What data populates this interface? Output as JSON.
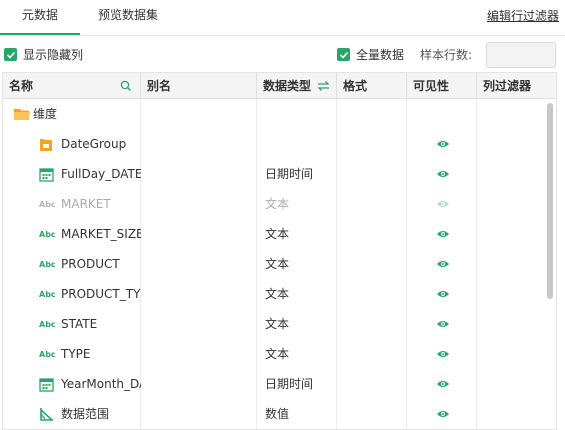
{
  "tabs": {
    "metadata": "元数据",
    "preview": "预览数据集"
  },
  "edit_filter_link": "编辑行过滤器",
  "options": {
    "show_hidden_label": "显示隐藏列",
    "show_hidden_checked": true,
    "full_data_label": "全量数据",
    "full_data_checked": true,
    "sample_rows_label": "样本行数:",
    "sample_rows_value": ""
  },
  "columns": {
    "name": "名称",
    "alias": "别名",
    "data_type": "数据类型",
    "format": "格式",
    "visibility": "可见性",
    "column_filter": "列过滤器"
  },
  "rows": [
    {
      "name": "维度",
      "type": "",
      "icon": "folder-icon",
      "visible": null
    },
    {
      "name": "DateGroup",
      "type": "",
      "icon": "date-group-icon",
      "visible": true
    },
    {
      "name": "FullDay_DATE",
      "type": "日期时间",
      "icon": "calendar-icon",
      "visible": true
    },
    {
      "name": "MARKET",
      "type": "文本",
      "icon": "text-abc-icon",
      "visible": false,
      "dimmed": true
    },
    {
      "name": "MARKET_SIZE",
      "type": "文本",
      "icon": "text-abc-icon",
      "visible": true
    },
    {
      "name": "PRODUCT",
      "type": "文本",
      "icon": "text-abc-icon",
      "visible": true
    },
    {
      "name": "PRODUCT_TYPE",
      "type": "文本",
      "icon": "text-abc-icon",
      "visible": true
    },
    {
      "name": "STATE",
      "type": "文本",
      "icon": "text-abc-icon",
      "visible": true
    },
    {
      "name": "TYPE",
      "type": "文本",
      "icon": "text-abc-icon",
      "visible": true
    },
    {
      "name": "YearMonth_DATE",
      "type": "日期时间",
      "icon": "calendar-icon",
      "visible": true
    },
    {
      "name": "数据范围",
      "type": "数值",
      "icon": "measure-icon",
      "visible": true
    }
  ],
  "abc_label": "Abc",
  "colors": {
    "accent": "#2aa56a",
    "folder": "#f4a423",
    "dimmed": "#b5b5b5"
  }
}
